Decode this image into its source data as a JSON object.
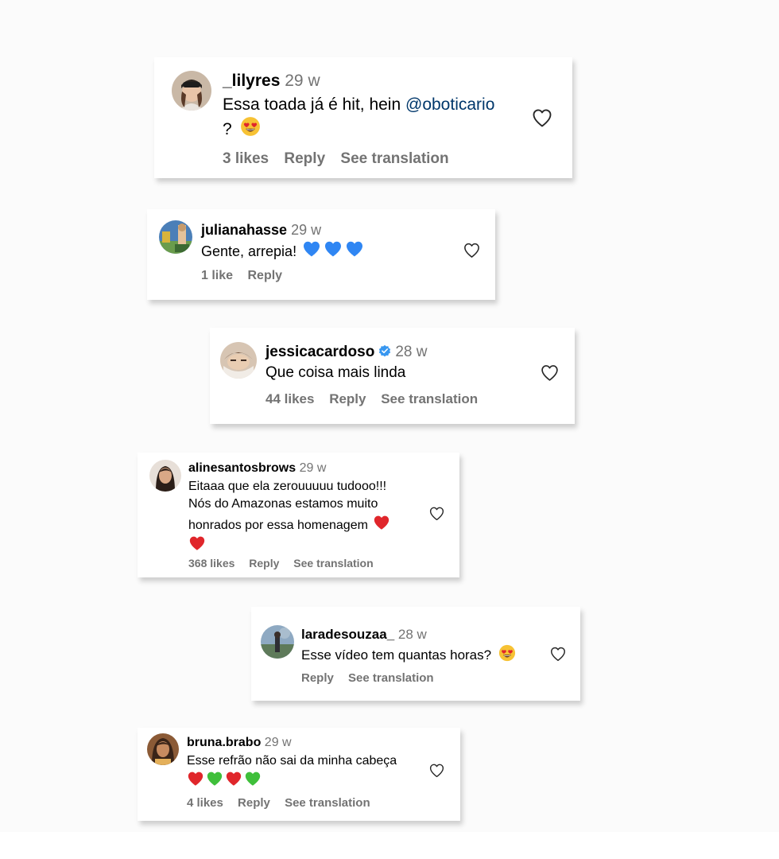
{
  "comments": [
    {
      "username": "_lilyres",
      "time": "29 w",
      "text_prefix": "Essa toada já é hit, hein ",
      "mention": "@oboticario",
      "text_suffix": "?",
      "emojis": [
        "heart-eyes"
      ],
      "likes": "3 likes",
      "reply": "Reply",
      "translation": "See translation"
    },
    {
      "username": "julianahasse",
      "time": "29 w",
      "text": "Gente, arrepia!",
      "emojis": [
        "blue-heart",
        "blue-heart",
        "blue-heart"
      ],
      "likes": "1 like",
      "reply": "Reply"
    },
    {
      "username": "jessicacardoso",
      "verified": true,
      "time": "28 w",
      "text": "Que coisa mais linda",
      "likes": "44 likes",
      "reply": "Reply",
      "translation": "See translation"
    },
    {
      "username": "alinesantosbrows",
      "time": "29 w",
      "text_line1": "Eitaaa que ela zerouuuuu tudooo!!!",
      "text_line2": "Nós do Amazonas estamos muito",
      "text_line3": "honrados por essa homenagem",
      "emojis": [
        "red-heart",
        "red-heart"
      ],
      "likes": "368 likes",
      "reply": "Reply",
      "translation": "See translation"
    },
    {
      "username": "laradesouzaa_",
      "time": "28 w",
      "text": "Esse vídeo tem quantas horas?",
      "emojis": [
        "heart-eyes"
      ],
      "reply": "Reply",
      "translation": "See translation"
    },
    {
      "username": "bruna.brabo",
      "time": "29 w",
      "text": "Esse refrão não sai da minha cabeça",
      "emojis": [
        "red-heart",
        "green-heart",
        "red-heart",
        "green-heart"
      ],
      "likes": "4 likes",
      "reply": "Reply",
      "translation": "See translation"
    }
  ],
  "colors": {
    "secondary_text": "#737373",
    "mention": "#00376b",
    "verified": "#3897f0",
    "red_heart": "#e0262b",
    "blue_heart": "#2f86f3",
    "green_heart": "#3fbf3a",
    "emoji_face": "#f7c234"
  }
}
